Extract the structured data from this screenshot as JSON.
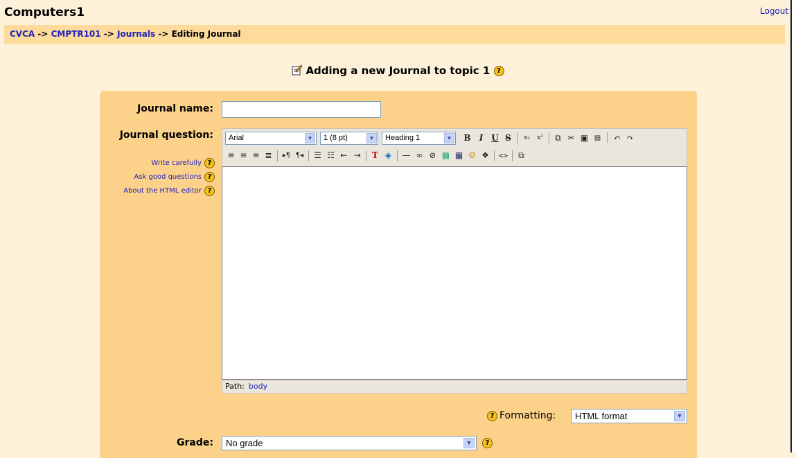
{
  "header": {
    "site_title": "Computers1",
    "logout_label": "Logout"
  },
  "breadcrumb": {
    "items": [
      "CVCA",
      "CMPTR101",
      "Journals"
    ],
    "current": "Editing Journal",
    "separator": "->"
  },
  "page_heading": "Adding a new Journal to topic 1",
  "form": {
    "name_label": "Journal name",
    "name_value": "",
    "question_label": "Journal question",
    "help_links": [
      "Write carefully",
      "Ask good questions",
      "About the HTML editor"
    ],
    "editor": {
      "font_select": "Arial",
      "size_select": "1 (8 pt)",
      "heading_select": "Heading 1",
      "path_label": "Path:",
      "path_value": "body"
    },
    "formatting_label": "Formatting:",
    "formatting_value": "HTML format",
    "grade_label": "Grade",
    "grade_value": "No grade"
  },
  "colors": {
    "page_bg": "#fdf1d9",
    "navbar_bg": "#fcdb9d",
    "form_bg": "#fcd28b",
    "link": "#2222bb"
  }
}
